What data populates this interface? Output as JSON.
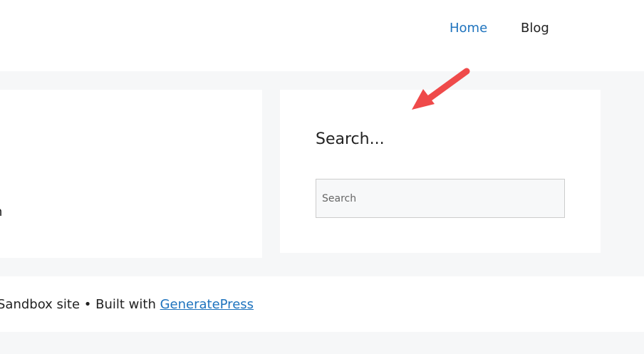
{
  "nav": {
    "home_label": "Home",
    "blog_label": "Blog"
  },
  "main": {
    "left_card_text": "n"
  },
  "sidebar": {
    "search_widget": {
      "title": "Search...",
      "input_placeholder": "Search",
      "input_value": ""
    }
  },
  "footer": {
    "text_prefix": "Sandbox site • Built with ",
    "link_label": "GeneratePress"
  },
  "annotation": {
    "icon": "red-arrow-icon",
    "color": "#ef4a4a"
  },
  "colors": {
    "accent": "#1e73be",
    "background": "#f6f7f8"
  }
}
